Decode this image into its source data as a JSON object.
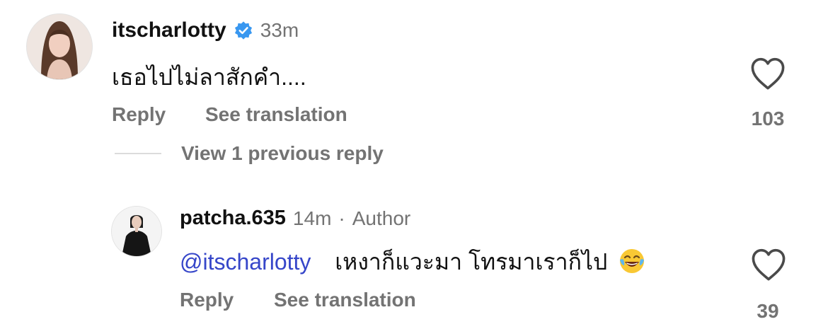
{
  "comments": [
    {
      "username": "itscharlotty",
      "verified": true,
      "time": "33m",
      "text": "เธอไปไม่ลาสักคำ....",
      "actions": {
        "reply": "Reply",
        "translate": "See translation"
      },
      "likes": "103"
    }
  ],
  "view_replies": "View 1 previous reply",
  "reply": {
    "username": "patcha.635",
    "time": "14m",
    "separator": "·",
    "author_label": "Author",
    "mention": "@itscharlotty",
    "text": "เหงาก็แวะมา โทรมาเราก็ไป",
    "emoji": "😂",
    "actions": {
      "reply": "Reply",
      "translate": "See translation"
    },
    "likes": "39"
  },
  "colors": {
    "verified_badge": "#3897f0",
    "mention": "#3646c9",
    "muted": "#737373"
  },
  "icons": [
    "verified-badge-icon",
    "heart-icon",
    "face-with-tears-of-joy-emoji"
  ]
}
